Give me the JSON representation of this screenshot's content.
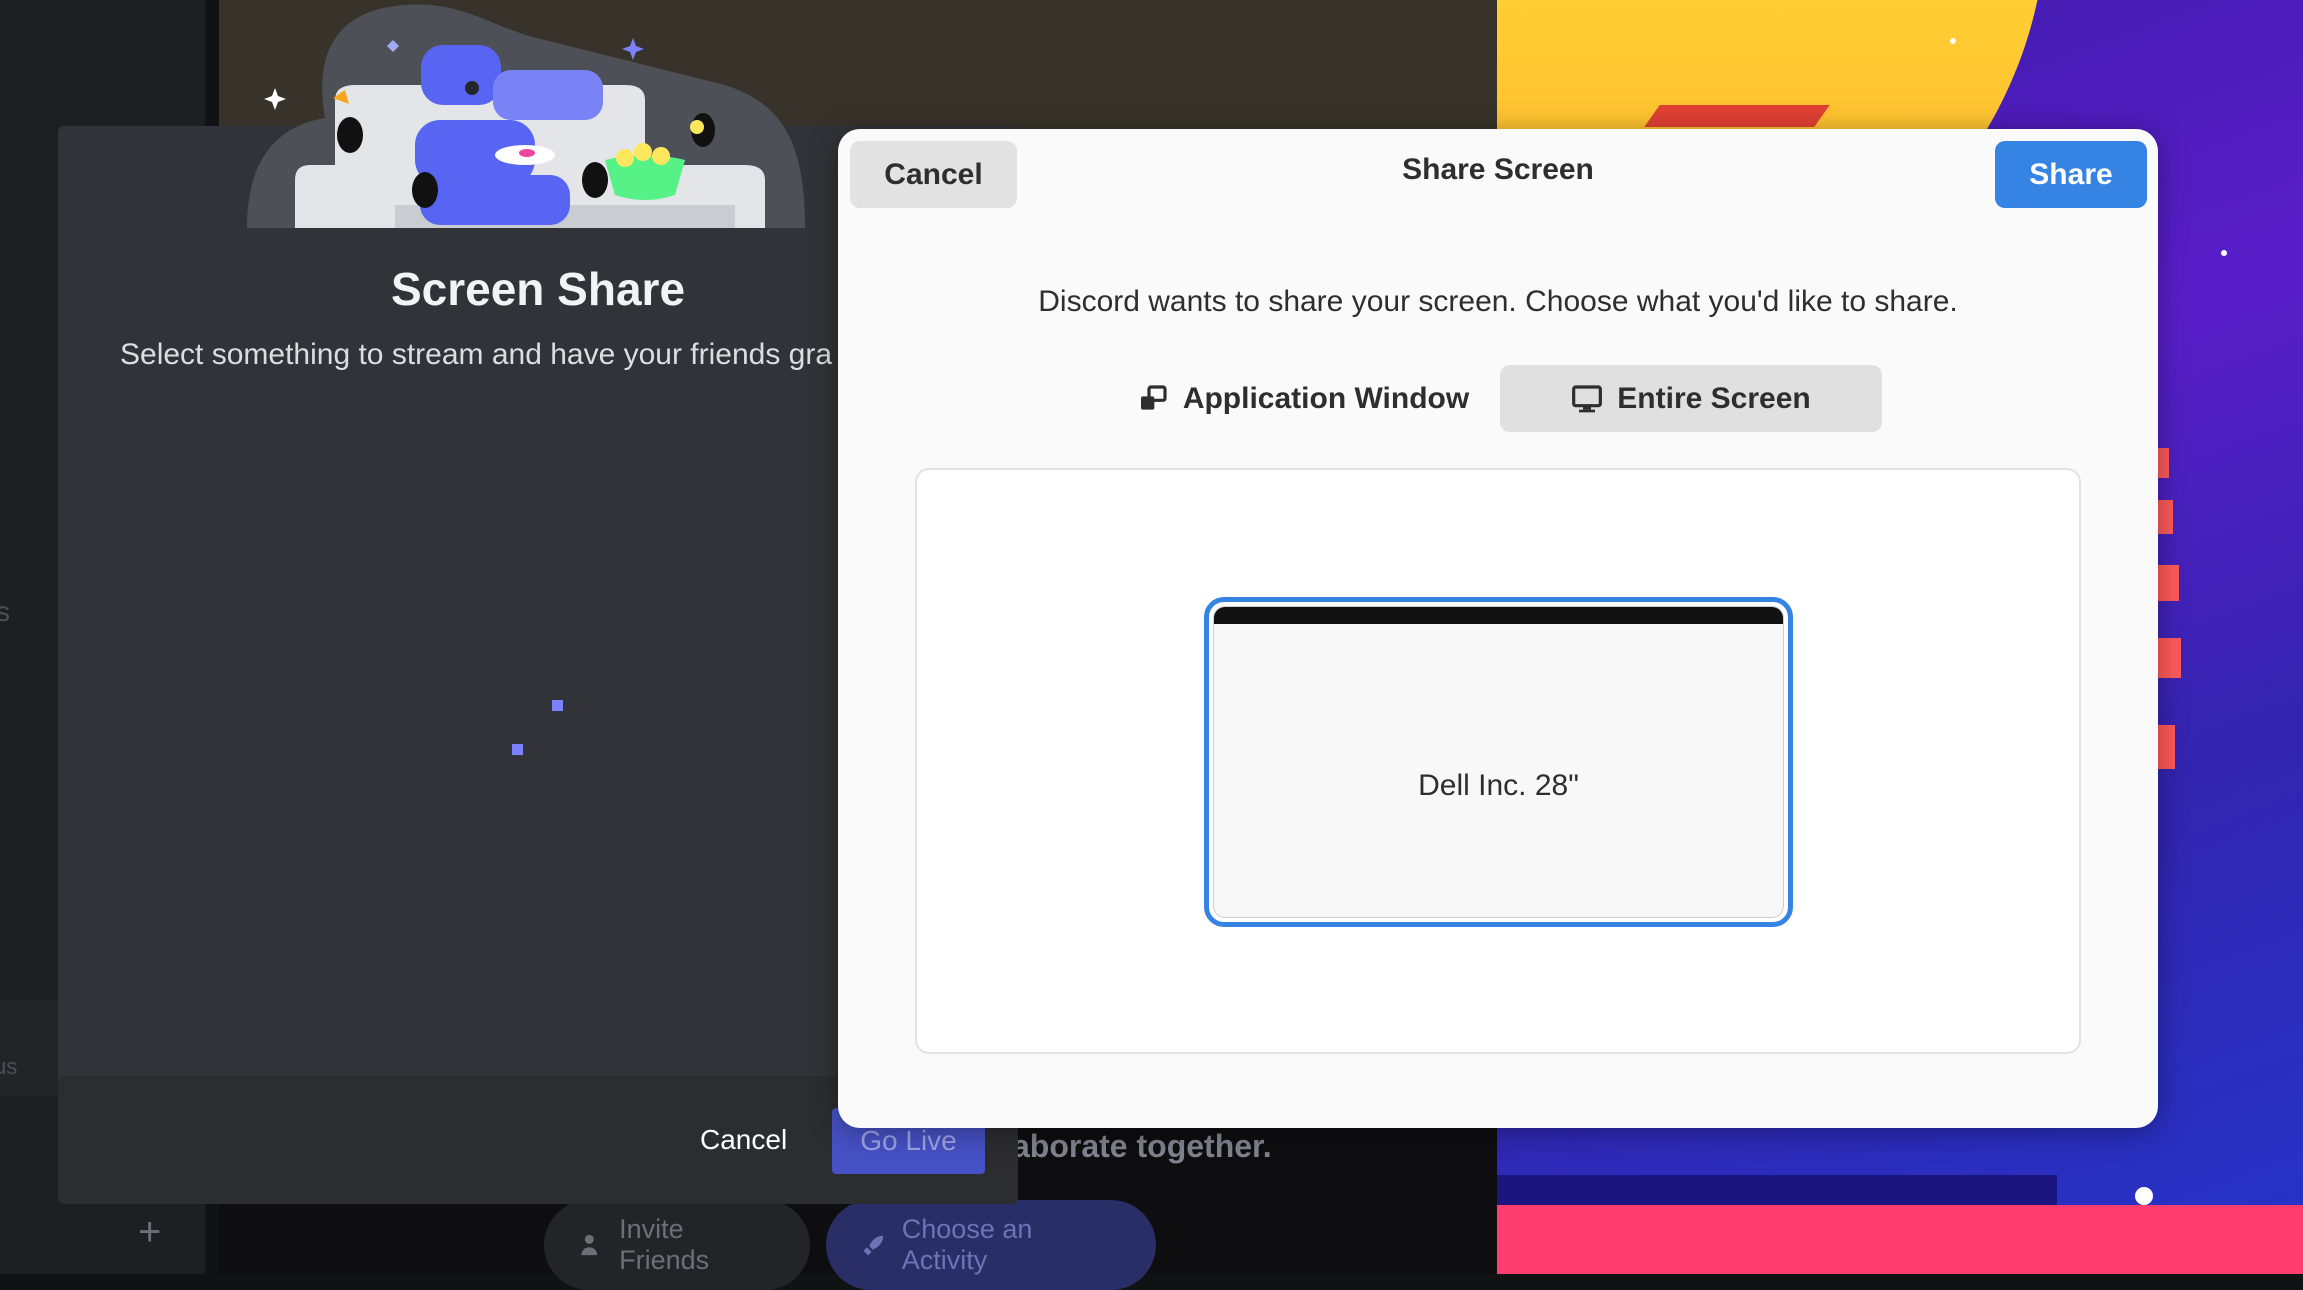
{
  "background": {
    "sidebar_stub": "s",
    "status_stub": "us",
    "add_button": "+",
    "collaborate_text": "aborate together.",
    "invite_friends": "Invite Friends",
    "choose_activity": "Choose an Activity"
  },
  "discord_dialog": {
    "title": "Screen Share",
    "subtitle": "Select something to stream and have your friends gra",
    "cancel_label": "Cancel",
    "go_live_label": "Go Live"
  },
  "portal": {
    "cancel_label": "Cancel",
    "title": "Share Screen",
    "share_label": "Share",
    "description": "Discord wants to share your screen. Choose what you'd like to share.",
    "tabs": [
      {
        "label": "Application Window",
        "icon": "application-window-icon",
        "selected": false
      },
      {
        "label": "Entire Screen",
        "icon": "monitor-icon",
        "selected": true
      }
    ],
    "monitors": [
      {
        "label": "Dell Inc. 28\"",
        "selected": true
      }
    ]
  },
  "colors": {
    "accent": "#3584e4",
    "discord_blurple": "#5865f2",
    "portal_bg": "#fafafa",
    "discord_modal_bg": "#313338"
  }
}
